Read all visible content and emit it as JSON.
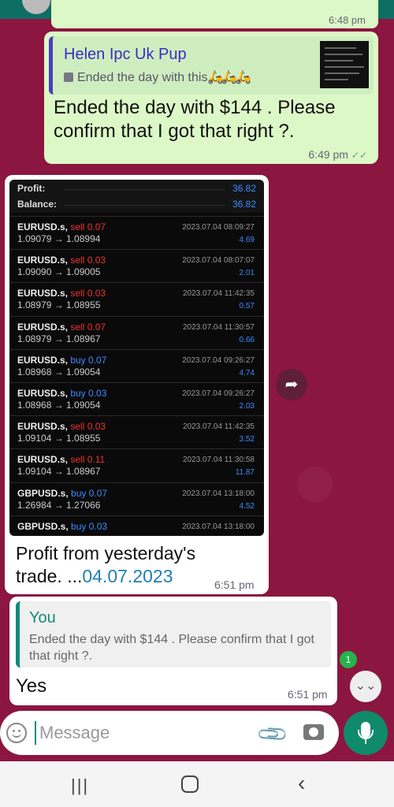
{
  "top_message": {
    "time": "6:48 pm"
  },
  "reply1": {
    "quoted_author": "Helen Ipc Uk Pup",
    "quoted_text": "Ended the day with this",
    "text": "Ended the day with $144 . Please confirm that I got that right ?.",
    "time": "6:49 pm"
  },
  "trade_screenshot": {
    "profit_label": "Profit:",
    "profit_value": "36.82",
    "balance_label": "Balance:",
    "balance_value": "36.82",
    "trades": [
      {
        "symbol": "EURUSD.s,",
        "side": "sell 0.07",
        "type": "sell",
        "price": "1.09079 → 1.08994",
        "date": "2023.07.04 08:09:27",
        "pl": "4.69"
      },
      {
        "symbol": "EURUSD.s,",
        "side": "sell 0.03",
        "type": "sell",
        "price": "1.09090 → 1.09005",
        "date": "2023.07.04 08:07:07",
        "pl": "2.01"
      },
      {
        "symbol": "EURUSD.s,",
        "side": "sell 0.03",
        "type": "sell",
        "price": "1.08979 → 1.08955",
        "date": "2023.07.04 11:42:35",
        "pl": "0.57"
      },
      {
        "symbol": "EURUSD.s,",
        "side": "sell 0.07",
        "type": "sell",
        "price": "1.08979 → 1.08967",
        "date": "2023.07.04 11:30:57",
        "pl": "0.66"
      },
      {
        "symbol": "EURUSD.s,",
        "side": "buy 0.07",
        "type": "buy",
        "price": "1.08968 → 1.09054",
        "date": "2023.07.04 09:26:27",
        "pl": "4.74"
      },
      {
        "symbol": "EURUSD.s,",
        "side": "buy 0.03",
        "type": "buy",
        "price": "1.08968 → 1.09054",
        "date": "2023.07.04 09:26:27",
        "pl": "2.03"
      },
      {
        "symbol": "EURUSD.s,",
        "side": "sell 0.03",
        "type": "sell",
        "price": "1.09104 → 1.08955",
        "date": "2023.07.04 11:42:35",
        "pl": "3.52"
      },
      {
        "symbol": "EURUSD.s,",
        "side": "sell 0.11",
        "type": "sell",
        "price": "1.09104 → 1.08967",
        "date": "2023.07.04 11:30:58",
        "pl": "11.87"
      },
      {
        "symbol": "GBPUSD.s,",
        "side": "buy 0.07",
        "type": "buy",
        "price": "1.26984 → 1.27066",
        "date": "2023.07.04 13:18:00",
        "pl": "4.52"
      },
      {
        "symbol": "GBPUSD.s,",
        "side": "buy 0.03",
        "type": "buy",
        "price": "",
        "date": "2023.07.04 13:18:00",
        "pl": ""
      }
    ]
  },
  "image_message": {
    "caption_prefix": "Profit from yesterday's trade. ...",
    "caption_link": "04.07.2023",
    "time": "6:51 pm"
  },
  "reply2": {
    "quoted_author": "You",
    "quoted_text": "Ended the day with $144 . Please confirm that I got that right ?.",
    "text": "Yes",
    "time": "6:51 pm"
  },
  "unread_count": "1",
  "composer": {
    "placeholder": "Message"
  },
  "colors": {
    "wallpaper": "#8b1640",
    "outgoing_bubble": "#dcf8c6",
    "accent": "#0f8a6a"
  }
}
